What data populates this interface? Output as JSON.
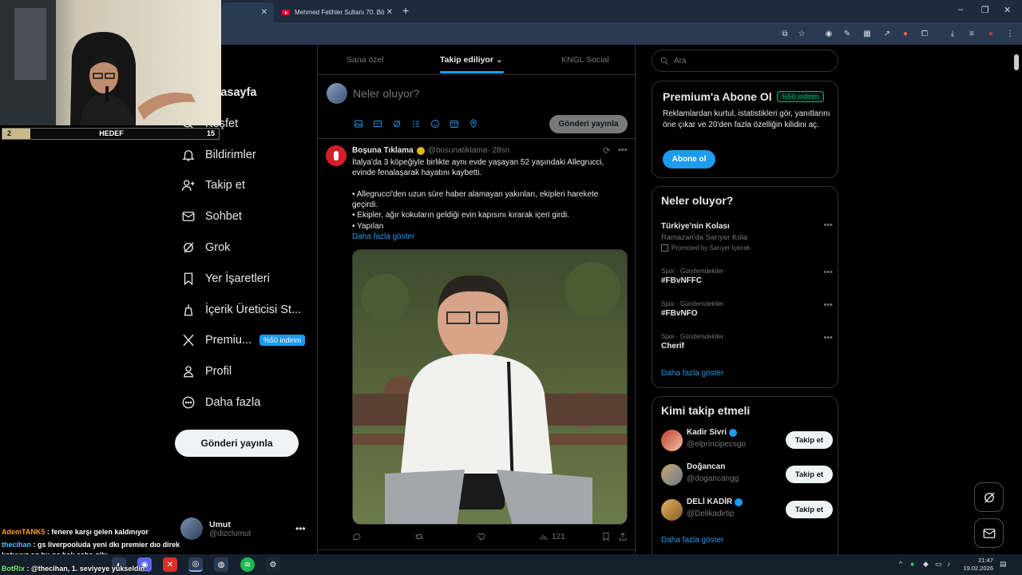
{
  "browser": {
    "tabs": [
      {
        "title": "",
        "active": true
      },
      {
        "title": "Mehmed Fetihler Sultanı 70. Bö",
        "active": false
      }
    ],
    "new_tab": "+",
    "window_controls": [
      "–",
      "❐",
      "✕"
    ]
  },
  "stream_overlay": {
    "goal": {
      "current": "2",
      "label": "HEDEF",
      "target": "15",
      "progress": 0.13
    },
    "chat": [
      {
        "user": "AdemTANK5",
        "message": ": fenere karşı gelen kaldınıyor"
      },
      {
        "user": "thecihan",
        "message": ": gs liverpooluda yeni dkı premier dıo direk"
      },
      {
        "user": "",
        "message": "kotuyuz ag bu ne halı saha gibı"
      },
      {
        "user": "BotRix",
        "message": ": @thecihan, 1. seviyeye yükseldin."
      }
    ]
  },
  "nav": {
    "items": [
      {
        "label": "Anasayfa",
        "icon": "home-icon"
      },
      {
        "label": "Keşfet",
        "icon": "search-icon"
      },
      {
        "label": "Bildirimler",
        "icon": "bell-icon"
      },
      {
        "label": "Takip et",
        "icon": "follow-icon"
      },
      {
        "label": "Sohbet",
        "icon": "mail-icon"
      },
      {
        "label": "Grok",
        "icon": "grok-icon"
      },
      {
        "label": "Yer İşaretleri",
        "icon": "bookmark-icon"
      },
      {
        "label": "İçerik Üreticisi St...",
        "icon": "creator-icon"
      },
      {
        "label": "Premiu...",
        "icon": "x-logo-icon",
        "badge": "%50 indirim"
      },
      {
        "label": "Profil",
        "icon": "profile-icon"
      },
      {
        "label": "Daha fazla",
        "icon": "more-icon"
      }
    ],
    "post_button": "Gönderi yayınla",
    "account": {
      "name": "Umut",
      "handle": "@dizclumut"
    }
  },
  "feed": {
    "tabs": [
      "Sana özel",
      "Takip ediliyor",
      "KNGL Social"
    ],
    "active_tab": "Takip ediliyor",
    "compose": {
      "placeholder": "Neler oluyor?",
      "publish": "Gönderi yayınla"
    },
    "tweet": {
      "name": "Boşuna Tıklama",
      "handle": "@bosunatiklama",
      "time": "· 28sn",
      "lines": [
        "İtalya'da 3 köpeğiyle birlikte aynı evde yaşayan 52 yaşındaki Allegrucci,",
        "evinde fenalaşarak hayatını kaybetti.",
        "",
        "• Allegrucci'den uzun süre haber alamayan yakınları, ekipleri harekete",
        "geçirdi.",
        "• Ekipler, ağır kokuların geldiği evin kapısını kırarak içeri girdi.",
        "• Yapılan"
      ],
      "show_more": "Daha fazla göster",
      "views": "121"
    }
  },
  "right": {
    "search_placeholder": "Ara",
    "premium": {
      "title": "Premium'a Abone Ol",
      "discount": "%50 indirim",
      "desc": "Reklamlardan kurtul, istatistikleri gör, yanıtlarını öne çıkar ve 20'den fazla özelliğin kilidini aç.",
      "button": "Abone ol"
    },
    "trends": {
      "title": "Neler oluyor?",
      "items": [
        {
          "meta": "",
          "title": "Türkiye'nin Kolası",
          "sub": "Ramazan'da Sarıyer Kola",
          "promo": "Promoted by Sarıyer İçecek"
        },
        {
          "meta": "Spor · Gündemdekiler",
          "title": "#FBvNFFC"
        },
        {
          "meta": "Spor · Gündemdekiler",
          "title": "#FBvNFO"
        },
        {
          "meta": "Spor · Gündemdekiler",
          "title": "Cherif"
        }
      ],
      "more": "Daha fazla göster"
    },
    "who_to_follow": {
      "title": "Kimi takip etmeli",
      "users": [
        {
          "name": "Kadir Sivri",
          "handle": "@elprincipecsgo",
          "verified": true,
          "button": "Takip et"
        },
        {
          "name": "Doğancan",
          "handle": "@dogancangg",
          "verified": false,
          "button": "Takip et"
        },
        {
          "name": "DELİ KADİR",
          "handle": "@Delikadirtip",
          "verified": true,
          "button": "Takip et"
        }
      ],
      "more": "Daha fazla göster"
    }
  },
  "taskbar": {
    "time": "21:47",
    "date": "19.02.2026"
  },
  "colors": {
    "accent": "#1d9bf0",
    "background": "#000000",
    "border": "#2f3336",
    "muted": "#71767b",
    "green": "#00ba7c"
  }
}
